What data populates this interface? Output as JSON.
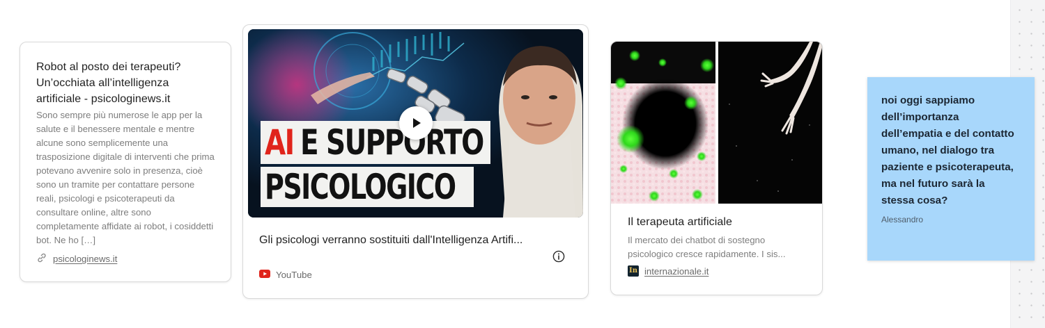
{
  "cards": [
    {
      "title": "Robot al posto dei terapeuti? Un’occhiata all’intelligenza artificiale - psicologinews.it",
      "description": "Sono sempre più numerose le app per la salute e il benessere mentale e mentre alcune sono semplicemente una trasposizione digitale di interventi che prima potevano avvenire solo in presenza, cioè sono un tramite per contattare persone reali, psicologi e psicoterapeuti da consultare online, altre sono completamente affidate ai robot, i cosiddetti bot. Ne ho […]",
      "source": "psicologinews.it",
      "source_icon": "link-icon"
    },
    {
      "thumbnail_text_line1_a": "AI",
      "thumbnail_text_line1_b": "E SUPPORTO",
      "thumbnail_text_line2": "PSICOLOGICO",
      "title": "Gli psicologi verranno sostituiti dall'Intelligenza Artifi...",
      "source": "YouTube",
      "source_icon": "youtube-icon",
      "accent_red": "#e0241b"
    },
    {
      "title": "Il terapeuta artificiale",
      "description": "Il mercato dei chatbot di sostegno psicologico cresce rapidamente. I sis...",
      "source": "internazionale.it",
      "source_icon": "internazionale-logo-icon",
      "source_logo_text": "In"
    }
  ],
  "note": {
    "text": "noi oggi sappiamo dell’importanza dell’empatia e del contatto umano, nel dialogo tra paziente e psicoterapeuta, ma nel futuro sarà la stessa cosa?",
    "author": "Alessandro",
    "color": "#a8d7fb"
  }
}
